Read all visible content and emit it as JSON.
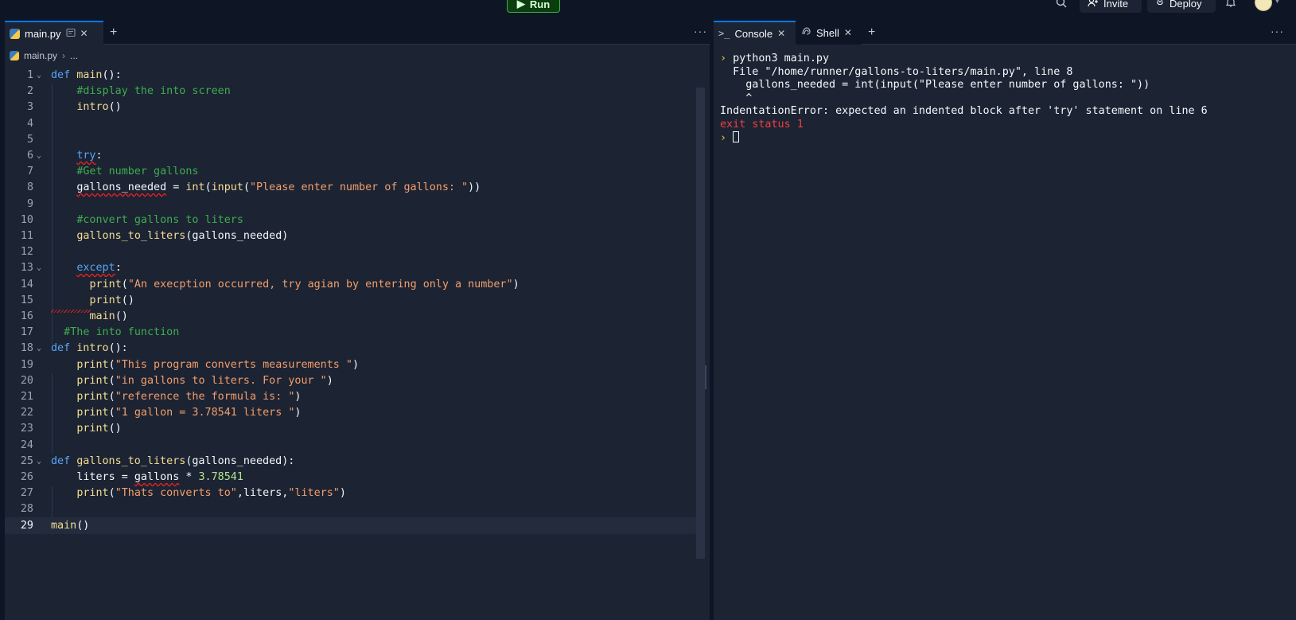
{
  "topbar": {
    "run_label": "Run",
    "invite_label": "Invite",
    "deploy_label": "Deploy"
  },
  "editor": {
    "tab_label": "main.py",
    "breadcrumb": [
      "main.py",
      "..."
    ],
    "current_line": 29,
    "lines": [
      {
        "n": "1",
        "fold": true,
        "indent": 0,
        "tokens": [
          {
            "t": "k",
            "v": "def"
          },
          {
            "t": "p",
            "v": " "
          },
          {
            "t": "f",
            "v": "main"
          },
          {
            "t": "p",
            "v": "():"
          }
        ]
      },
      {
        "n": "2",
        "indent": 4,
        "tokens": [
          {
            "t": "c",
            "v": "#display the into screen"
          }
        ]
      },
      {
        "n": "3",
        "indent": 4,
        "tokens": [
          {
            "t": "f",
            "v": "intro"
          },
          {
            "t": "p",
            "v": "()"
          }
        ]
      },
      {
        "n": "4",
        "indent": 0,
        "tokens": []
      },
      {
        "n": "5",
        "indent": 0,
        "tokens": []
      },
      {
        "n": "6",
        "fold": true,
        "indent": 4,
        "tokens": [
          {
            "t": "k err",
            "v": "try"
          },
          {
            "t": "p",
            "v": ":"
          }
        ]
      },
      {
        "n": "7",
        "indent": 4,
        "tokens": [
          {
            "t": "c",
            "v": "#Get number gallons"
          }
        ]
      },
      {
        "n": "8",
        "indent": 4,
        "tokens": [
          {
            "t": "p err",
            "v": "gallons_needed"
          },
          {
            "t": "p",
            "v": " = "
          },
          {
            "t": "f",
            "v": "int"
          },
          {
            "t": "p",
            "v": "("
          },
          {
            "t": "f",
            "v": "input"
          },
          {
            "t": "p",
            "v": "("
          },
          {
            "t": "s",
            "v": "\"Please enter number of gallons: \""
          },
          {
            "t": "p",
            "v": "))"
          }
        ]
      },
      {
        "n": "9",
        "indent": 0,
        "tokens": []
      },
      {
        "n": "10",
        "indent": 4,
        "tokens": [
          {
            "t": "c",
            "v": "#convert gallons to liters"
          }
        ]
      },
      {
        "n": "11",
        "indent": 4,
        "tokens": [
          {
            "t": "f",
            "v": "gallons_to_liters"
          },
          {
            "t": "p",
            "v": "(gallons_needed)"
          }
        ]
      },
      {
        "n": "12",
        "indent": 0,
        "tokens": []
      },
      {
        "n": "13",
        "fold": true,
        "indent": 4,
        "tokens": [
          {
            "t": "k err",
            "v": "except"
          },
          {
            "t": "p",
            "v": ":"
          }
        ]
      },
      {
        "n": "14",
        "indent": 6,
        "tokens": [
          {
            "t": "f",
            "v": "print"
          },
          {
            "t": "p",
            "v": "("
          },
          {
            "t": "s",
            "v": "\"An execption occurred, try agian by entering only a number\""
          },
          {
            "t": "p",
            "v": ")"
          }
        ]
      },
      {
        "n": "15",
        "indent": 6,
        "tokens": [
          {
            "t": "f",
            "v": "print"
          },
          {
            "t": "p",
            "v": "()"
          }
        ]
      },
      {
        "n": "16",
        "indent": 6,
        "tokens": [
          {
            "t": "f",
            "v": "main"
          },
          {
            "t": "p",
            "v": "()"
          }
        ]
      },
      {
        "n": "17",
        "indent": 2,
        "tokens": [
          {
            "t": "c",
            "v": "#The into function"
          }
        ]
      },
      {
        "n": "18",
        "fold": true,
        "indent": 0,
        "tokens": [
          {
            "t": "k",
            "v": "def"
          },
          {
            "t": "p",
            "v": " "
          },
          {
            "t": "f",
            "v": "intro"
          },
          {
            "t": "p",
            "v": "():"
          }
        ]
      },
      {
        "n": "19",
        "indent": 4,
        "tokens": [
          {
            "t": "f",
            "v": "print"
          },
          {
            "t": "p",
            "v": "("
          },
          {
            "t": "s",
            "v": "\"This program converts measurements \""
          },
          {
            "t": "p",
            "v": ")"
          }
        ]
      },
      {
        "n": "20",
        "indent": 4,
        "tokens": [
          {
            "t": "f",
            "v": "print"
          },
          {
            "t": "p",
            "v": "("
          },
          {
            "t": "s",
            "v": "\"in gallons to liters. For your \""
          },
          {
            "t": "p",
            "v": ")"
          }
        ]
      },
      {
        "n": "21",
        "indent": 4,
        "tokens": [
          {
            "t": "f",
            "v": "print"
          },
          {
            "t": "p",
            "v": "("
          },
          {
            "t": "s",
            "v": "\"reference the formula is: \""
          },
          {
            "t": "p",
            "v": ")"
          }
        ]
      },
      {
        "n": "22",
        "indent": 4,
        "tokens": [
          {
            "t": "f",
            "v": "print"
          },
          {
            "t": "p",
            "v": "("
          },
          {
            "t": "s",
            "v": "\"1 gallon = 3.78541 liters \""
          },
          {
            "t": "p",
            "v": ")"
          }
        ]
      },
      {
        "n": "23",
        "indent": 4,
        "tokens": [
          {
            "t": "f",
            "v": "print"
          },
          {
            "t": "p",
            "v": "()"
          }
        ]
      },
      {
        "n": "24",
        "indent": 0,
        "tokens": []
      },
      {
        "n": "25",
        "fold": true,
        "indent": 0,
        "tokens": [
          {
            "t": "k",
            "v": "def"
          },
          {
            "t": "p",
            "v": " "
          },
          {
            "t": "f",
            "v": "gallons_to_liters"
          },
          {
            "t": "p",
            "v": "(gallons_needed):"
          }
        ]
      },
      {
        "n": "26",
        "indent": 4,
        "tokens": [
          {
            "t": "p",
            "v": "liters = "
          },
          {
            "t": "p err",
            "v": "gallons"
          },
          {
            "t": "p",
            "v": " * "
          },
          {
            "t": "n",
            "v": "3.78541"
          }
        ]
      },
      {
        "n": "27",
        "indent": 4,
        "tokens": [
          {
            "t": "f",
            "v": "print"
          },
          {
            "t": "p",
            "v": "("
          },
          {
            "t": "s",
            "v": "\"Thats converts to\""
          },
          {
            "t": "p",
            "v": ",liters,"
          },
          {
            "t": "s",
            "v": "\"liters\""
          },
          {
            "t": "p",
            "v": ")"
          }
        ]
      },
      {
        "n": "28",
        "indent": 0,
        "tokens": []
      },
      {
        "n": "29",
        "indent": 0,
        "tokens": [
          {
            "t": "f",
            "v": "main"
          },
          {
            "t": "p",
            "v": "()"
          }
        ]
      }
    ]
  },
  "console": {
    "tabs": [
      {
        "label": "Console",
        "icon": ">_"
      },
      {
        "label": "Shell",
        "icon": "shell-icon"
      }
    ],
    "prompt_glyph": "›",
    "command": "python3 main.py",
    "traceback": [
      "  File \"/home/runner/gallons-to-liters/main.py\", line 8",
      "    gallons_needed = int(input(\"Please enter number of gallons: \"))",
      "    ^"
    ],
    "error": "IndentationError: expected an indented block after 'try' statement on line 6",
    "exit_status": "exit status 1"
  },
  "colors": {
    "background": "#0e1525",
    "panel": "#1c2333",
    "accent": "#0079f2",
    "run_green": "#3cb043",
    "error_red": "#f23f42"
  }
}
